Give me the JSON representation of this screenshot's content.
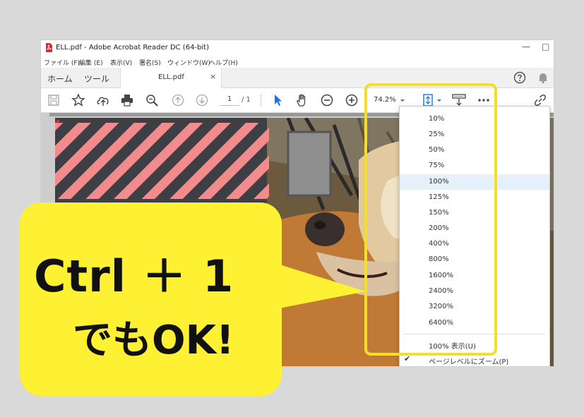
{
  "window": {
    "title": "ELL.pdf - Adobe Acrobat Reader DC (64-bit)",
    "controls": [
      "—",
      "□"
    ]
  },
  "menubar": [
    "ファイル (F)",
    "編集 (E)",
    "表示(V)",
    "署名(S)",
    "ウィンドウ(W)",
    "ヘルプ(H)"
  ],
  "tabs": {
    "home": "ホーム",
    "tools": "ツール",
    "document": "ELL.pdf",
    "close": "×"
  },
  "toolbar": {
    "page_current": "1",
    "page_total": "/ 1",
    "zoom_value": "74.2%",
    "icons": [
      "save-icon",
      "star-icon",
      "cloud-upload-icon",
      "print-icon",
      "zoom-search-icon",
      "page-up-icon",
      "page-down-icon",
      "select-cursor-icon",
      "hand-icon",
      "zoom-out-icon",
      "zoom-in-icon",
      "zoom-dropdown-icon",
      "fit-page-icon",
      "scroll-mode-icon",
      "more-icon",
      "share-link-icon"
    ]
  },
  "zoom_menu": {
    "items": [
      "10%",
      "25%",
      "50%",
      "75%",
      "100%",
      "125%",
      "150%",
      "200%",
      "400%",
      "800%",
      "1600%",
      "2400%",
      "3200%",
      "6400%"
    ],
    "selected": "100%",
    "actual_size": "100% 表示(U)",
    "page_level": "ページレベルにズーム(P)"
  },
  "callout": {
    "line1": "Ctrl ＋ 1",
    "line2": "でもOK!"
  },
  "colors": {
    "highlight": "#f3de2c",
    "bubble": "#fef032",
    "hatch": "#f28b8b"
  }
}
